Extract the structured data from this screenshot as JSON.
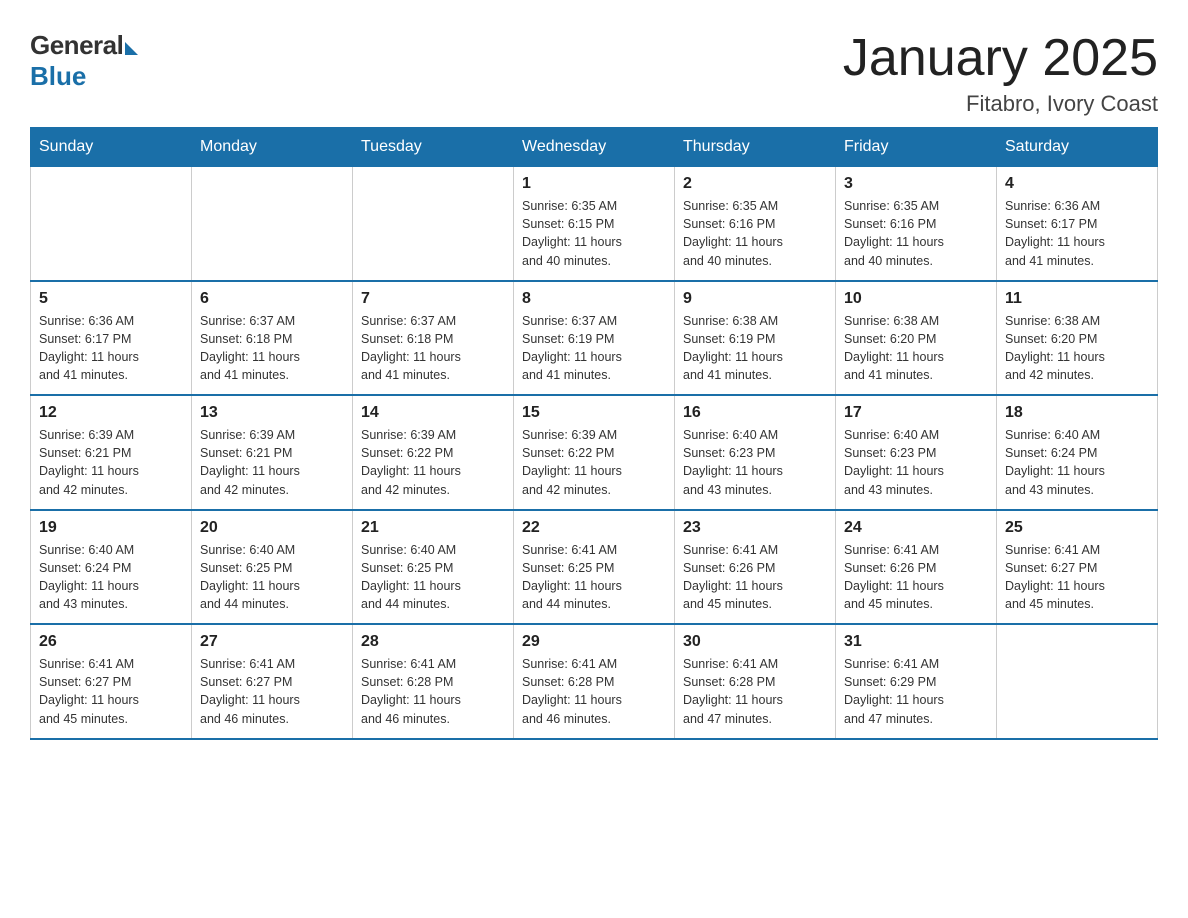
{
  "logo": {
    "general": "General",
    "blue": "Blue"
  },
  "title": "January 2025",
  "subtitle": "Fitabro, Ivory Coast",
  "days_of_week": [
    "Sunday",
    "Monday",
    "Tuesday",
    "Wednesday",
    "Thursday",
    "Friday",
    "Saturday"
  ],
  "weeks": [
    [
      {
        "day": "",
        "info": ""
      },
      {
        "day": "",
        "info": ""
      },
      {
        "day": "",
        "info": ""
      },
      {
        "day": "1",
        "info": "Sunrise: 6:35 AM\nSunset: 6:15 PM\nDaylight: 11 hours\nand 40 minutes."
      },
      {
        "day": "2",
        "info": "Sunrise: 6:35 AM\nSunset: 6:16 PM\nDaylight: 11 hours\nand 40 minutes."
      },
      {
        "day": "3",
        "info": "Sunrise: 6:35 AM\nSunset: 6:16 PM\nDaylight: 11 hours\nand 40 minutes."
      },
      {
        "day": "4",
        "info": "Sunrise: 6:36 AM\nSunset: 6:17 PM\nDaylight: 11 hours\nand 41 minutes."
      }
    ],
    [
      {
        "day": "5",
        "info": "Sunrise: 6:36 AM\nSunset: 6:17 PM\nDaylight: 11 hours\nand 41 minutes."
      },
      {
        "day": "6",
        "info": "Sunrise: 6:37 AM\nSunset: 6:18 PM\nDaylight: 11 hours\nand 41 minutes."
      },
      {
        "day": "7",
        "info": "Sunrise: 6:37 AM\nSunset: 6:18 PM\nDaylight: 11 hours\nand 41 minutes."
      },
      {
        "day": "8",
        "info": "Sunrise: 6:37 AM\nSunset: 6:19 PM\nDaylight: 11 hours\nand 41 minutes."
      },
      {
        "day": "9",
        "info": "Sunrise: 6:38 AM\nSunset: 6:19 PM\nDaylight: 11 hours\nand 41 minutes."
      },
      {
        "day": "10",
        "info": "Sunrise: 6:38 AM\nSunset: 6:20 PM\nDaylight: 11 hours\nand 41 minutes."
      },
      {
        "day": "11",
        "info": "Sunrise: 6:38 AM\nSunset: 6:20 PM\nDaylight: 11 hours\nand 42 minutes."
      }
    ],
    [
      {
        "day": "12",
        "info": "Sunrise: 6:39 AM\nSunset: 6:21 PM\nDaylight: 11 hours\nand 42 minutes."
      },
      {
        "day": "13",
        "info": "Sunrise: 6:39 AM\nSunset: 6:21 PM\nDaylight: 11 hours\nand 42 minutes."
      },
      {
        "day": "14",
        "info": "Sunrise: 6:39 AM\nSunset: 6:22 PM\nDaylight: 11 hours\nand 42 minutes."
      },
      {
        "day": "15",
        "info": "Sunrise: 6:39 AM\nSunset: 6:22 PM\nDaylight: 11 hours\nand 42 minutes."
      },
      {
        "day": "16",
        "info": "Sunrise: 6:40 AM\nSunset: 6:23 PM\nDaylight: 11 hours\nand 43 minutes."
      },
      {
        "day": "17",
        "info": "Sunrise: 6:40 AM\nSunset: 6:23 PM\nDaylight: 11 hours\nand 43 minutes."
      },
      {
        "day": "18",
        "info": "Sunrise: 6:40 AM\nSunset: 6:24 PM\nDaylight: 11 hours\nand 43 minutes."
      }
    ],
    [
      {
        "day": "19",
        "info": "Sunrise: 6:40 AM\nSunset: 6:24 PM\nDaylight: 11 hours\nand 43 minutes."
      },
      {
        "day": "20",
        "info": "Sunrise: 6:40 AM\nSunset: 6:25 PM\nDaylight: 11 hours\nand 44 minutes."
      },
      {
        "day": "21",
        "info": "Sunrise: 6:40 AM\nSunset: 6:25 PM\nDaylight: 11 hours\nand 44 minutes."
      },
      {
        "day": "22",
        "info": "Sunrise: 6:41 AM\nSunset: 6:25 PM\nDaylight: 11 hours\nand 44 minutes."
      },
      {
        "day": "23",
        "info": "Sunrise: 6:41 AM\nSunset: 6:26 PM\nDaylight: 11 hours\nand 45 minutes."
      },
      {
        "day": "24",
        "info": "Sunrise: 6:41 AM\nSunset: 6:26 PM\nDaylight: 11 hours\nand 45 minutes."
      },
      {
        "day": "25",
        "info": "Sunrise: 6:41 AM\nSunset: 6:27 PM\nDaylight: 11 hours\nand 45 minutes."
      }
    ],
    [
      {
        "day": "26",
        "info": "Sunrise: 6:41 AM\nSunset: 6:27 PM\nDaylight: 11 hours\nand 45 minutes."
      },
      {
        "day": "27",
        "info": "Sunrise: 6:41 AM\nSunset: 6:27 PM\nDaylight: 11 hours\nand 46 minutes."
      },
      {
        "day": "28",
        "info": "Sunrise: 6:41 AM\nSunset: 6:28 PM\nDaylight: 11 hours\nand 46 minutes."
      },
      {
        "day": "29",
        "info": "Sunrise: 6:41 AM\nSunset: 6:28 PM\nDaylight: 11 hours\nand 46 minutes."
      },
      {
        "day": "30",
        "info": "Sunrise: 6:41 AM\nSunset: 6:28 PM\nDaylight: 11 hours\nand 47 minutes."
      },
      {
        "day": "31",
        "info": "Sunrise: 6:41 AM\nSunset: 6:29 PM\nDaylight: 11 hours\nand 47 minutes."
      },
      {
        "day": "",
        "info": ""
      }
    ]
  ]
}
